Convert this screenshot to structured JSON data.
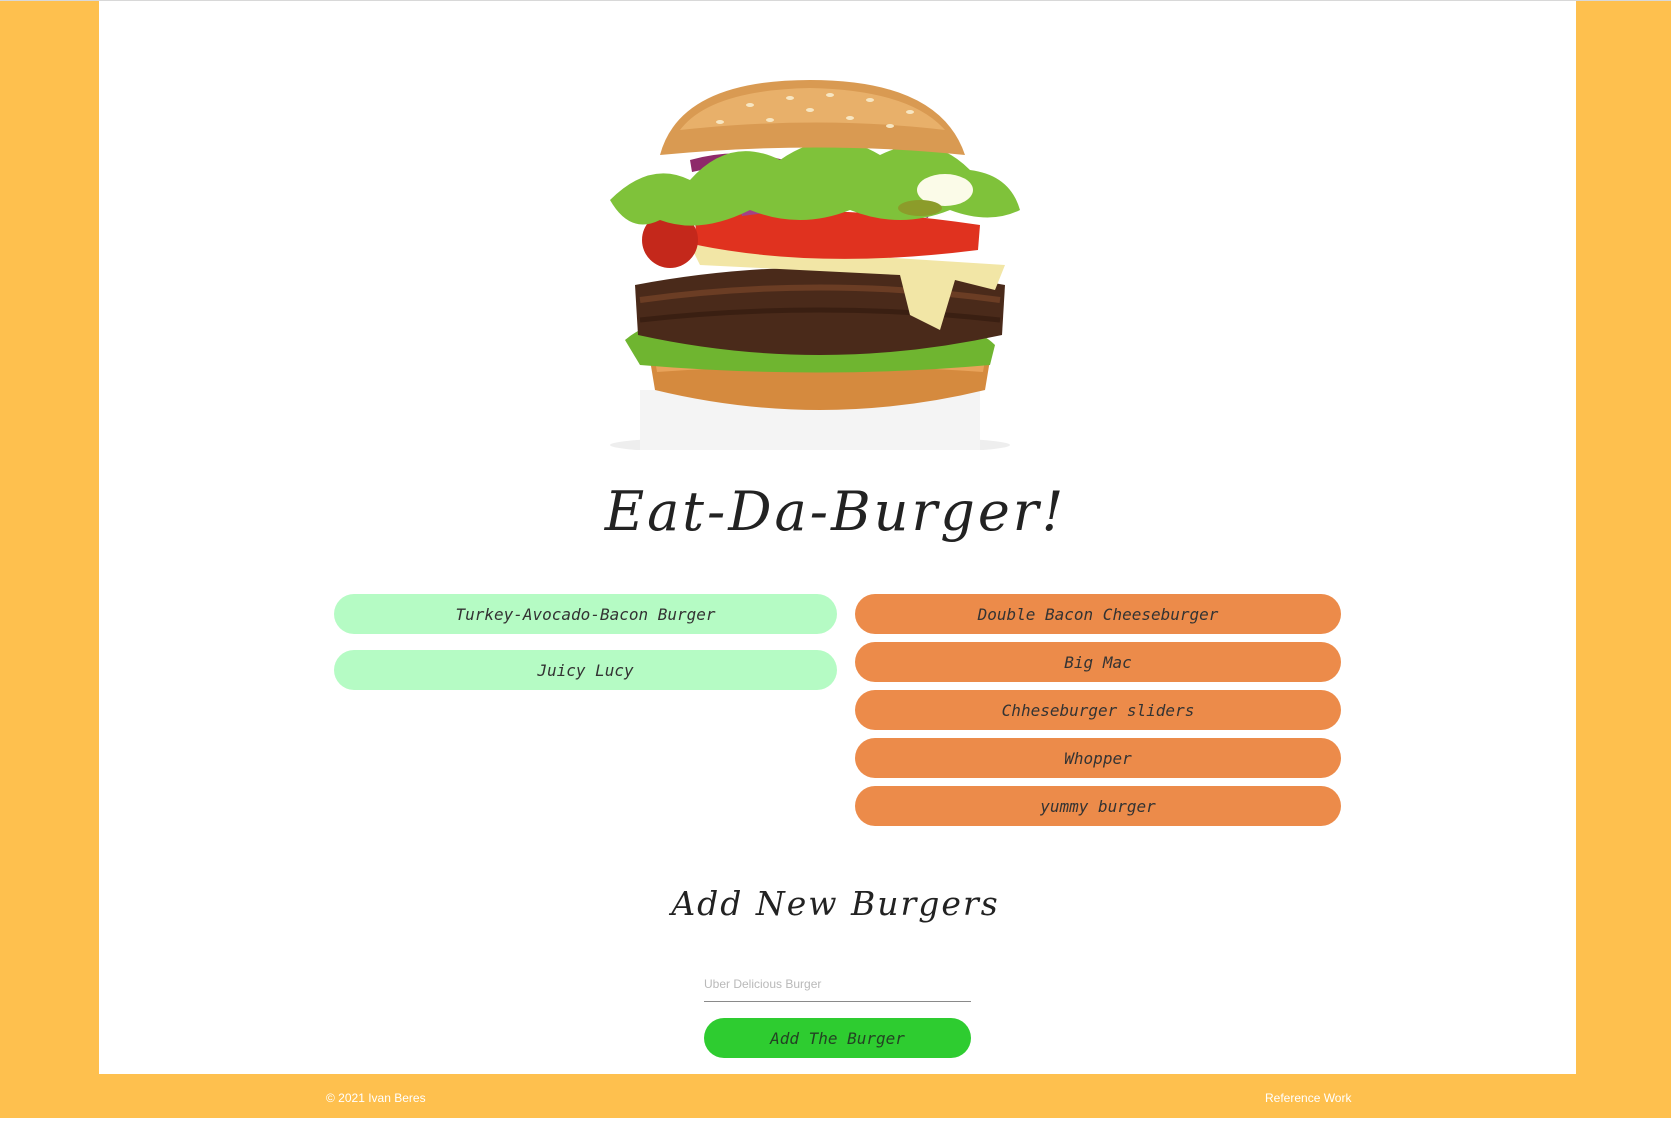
{
  "colors": {
    "page_background": "#fec04e",
    "card_background": "#ffffff",
    "pill_uneaten": "#b5fbc4",
    "pill_eaten": "#ec8b4a",
    "add_button": "#2ecc30"
  },
  "hero": {
    "image": "burger-photo"
  },
  "title": "Eat-Da-Burger!",
  "burgers_left": [
    "Turkey-Avocado-Bacon Burger",
    "Juicy Lucy"
  ],
  "burgers_right": [
    "Double Bacon Cheeseburger",
    "Big Mac",
    "Chheseburger sliders",
    "Whopper",
    "yummy burger"
  ],
  "add_section": {
    "heading": "Add New Burgers",
    "input_placeholder": "Uber Delicious Burger",
    "input_value": "",
    "button_label": "Add The Burger"
  },
  "footer": {
    "copyright": "© 2021 Ivan Beres",
    "link_label": "Reference Work"
  }
}
